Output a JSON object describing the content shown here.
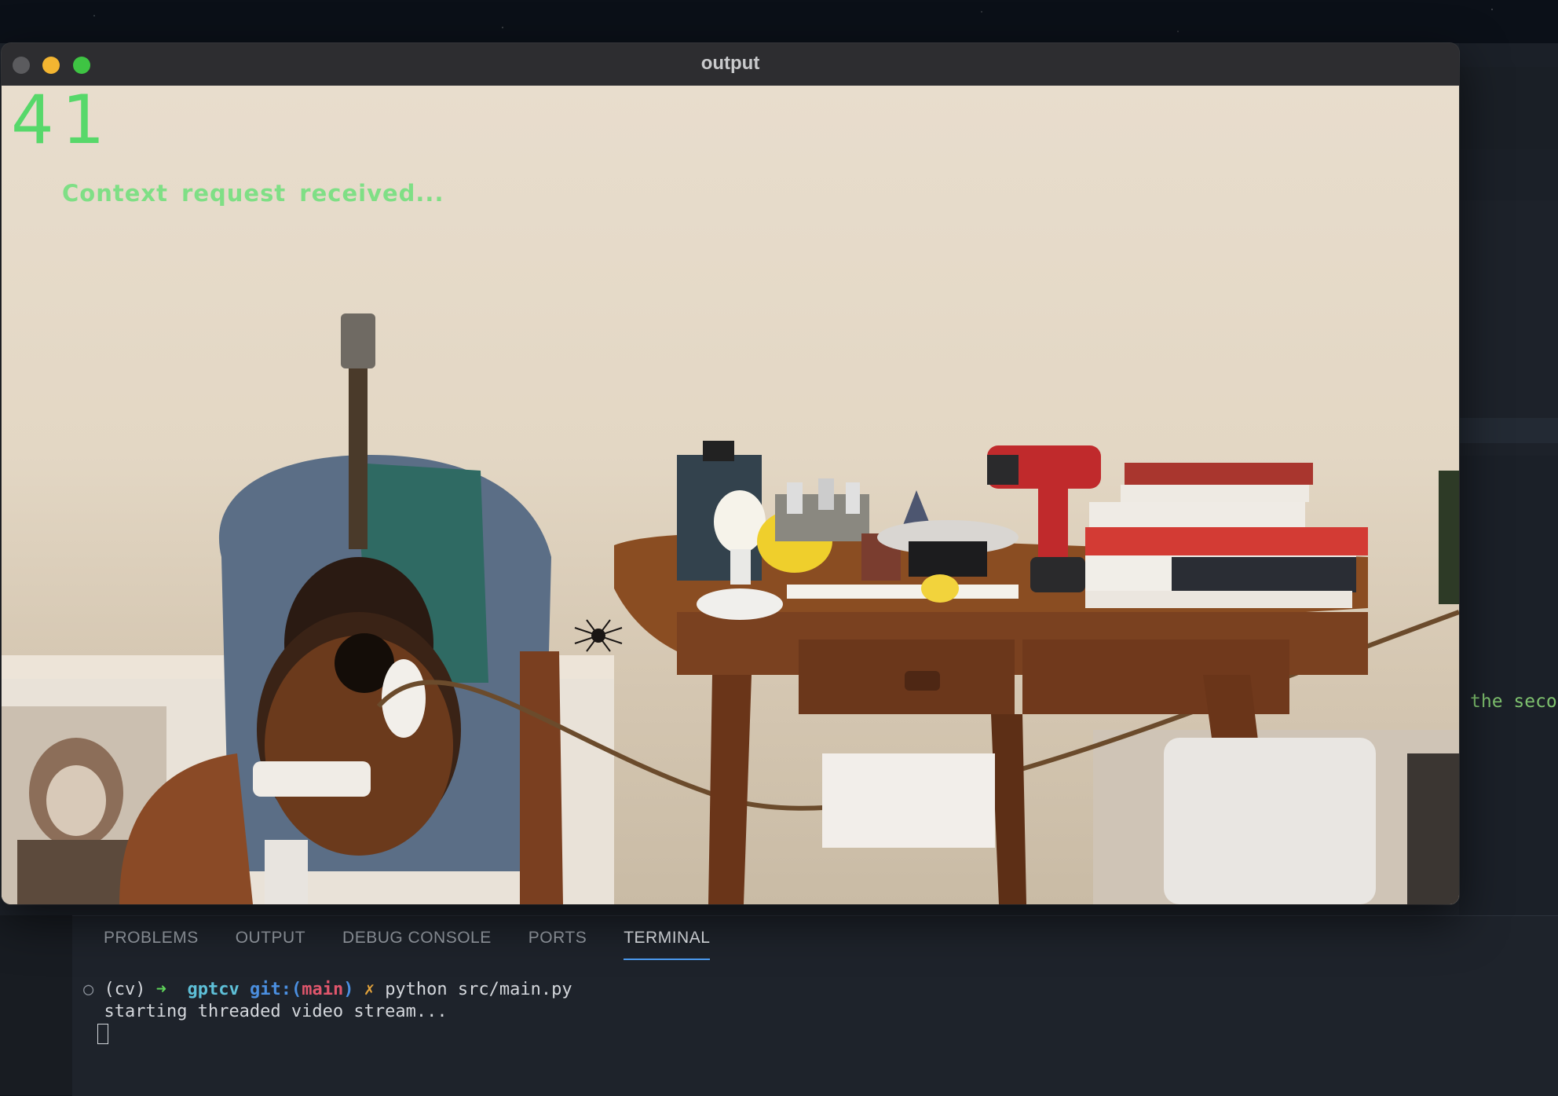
{
  "window": {
    "title": "output",
    "controls": [
      "close",
      "minimize",
      "maximize"
    ]
  },
  "video": {
    "frame_counter": "41",
    "overlay_status": "Context request received..."
  },
  "editor": {
    "partial_text": "the seco"
  },
  "panel": {
    "tabs": [
      {
        "label": "PROBLEMS",
        "active": false
      },
      {
        "label": "OUTPUT",
        "active": false
      },
      {
        "label": "DEBUG CONSOLE",
        "active": false
      },
      {
        "label": "PORTS",
        "active": false
      },
      {
        "label": "TERMINAL",
        "active": true
      }
    ]
  },
  "terminal": {
    "prompt_env": "(cv)",
    "prompt_arrow": "➜",
    "repo": "gptcv",
    "git_label": "git:(",
    "branch": "main",
    "git_close": ")",
    "dirty_mark": "✗",
    "command": "python src/main.py",
    "output_line": "starting threaded video stream..."
  }
}
